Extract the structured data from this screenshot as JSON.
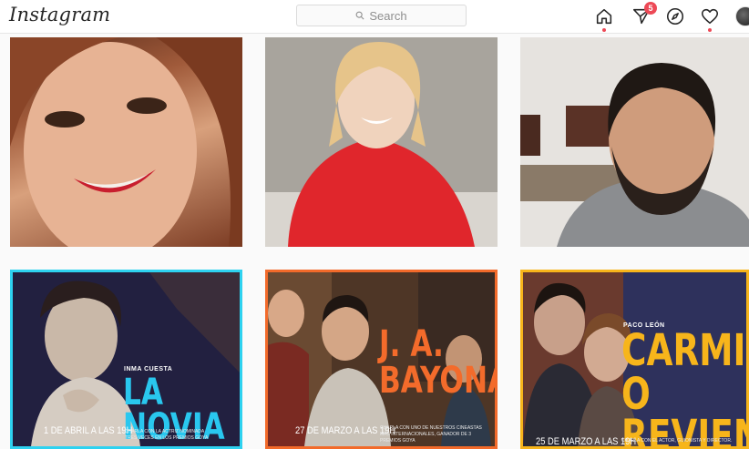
{
  "app": {
    "logo": "Instagram"
  },
  "search": {
    "placeholder": "Search"
  },
  "nav": {
    "messages_badge": "5"
  },
  "colors": {
    "accent_red": "#ed4956",
    "poster1_border": "#2ed2f0",
    "poster2_border": "#f26a2a",
    "poster3_border": "#f7b51b",
    "title_blue": "#29c7ef",
    "title_orange": "#f36b2b",
    "title_yellow": "#f7b51b"
  },
  "posters": [
    {
      "kicker": "INMA CUESTA",
      "title": "LA NOVIA",
      "date": "1 DE ABRIL A LAS 19H",
      "desc": "CHARLA CON LA ACTRIZ NOMINADA TRES VECES EN LOS PREMIOS GOYA"
    },
    {
      "kicker": "",
      "title_line1": "J. A.",
      "title_line2": "BAYONA",
      "date": "27 DE MARZO A LAS 19H",
      "desc": "CHARLA CON UNO DE NUESTROS CINEASTAS MÁS INTERNACIONALES, GANADOR DE 3 PREMIOS GOYA"
    },
    {
      "kicker": "PACO LEÓN",
      "title_line1": "CARMINA",
      "title_line2": "O REVIENTA",
      "date": "25 DE MARZO A LAS 19H",
      "desc": "CHARLA CON EL ACTOR, GUIONISTA Y DIRECTOR."
    }
  ]
}
